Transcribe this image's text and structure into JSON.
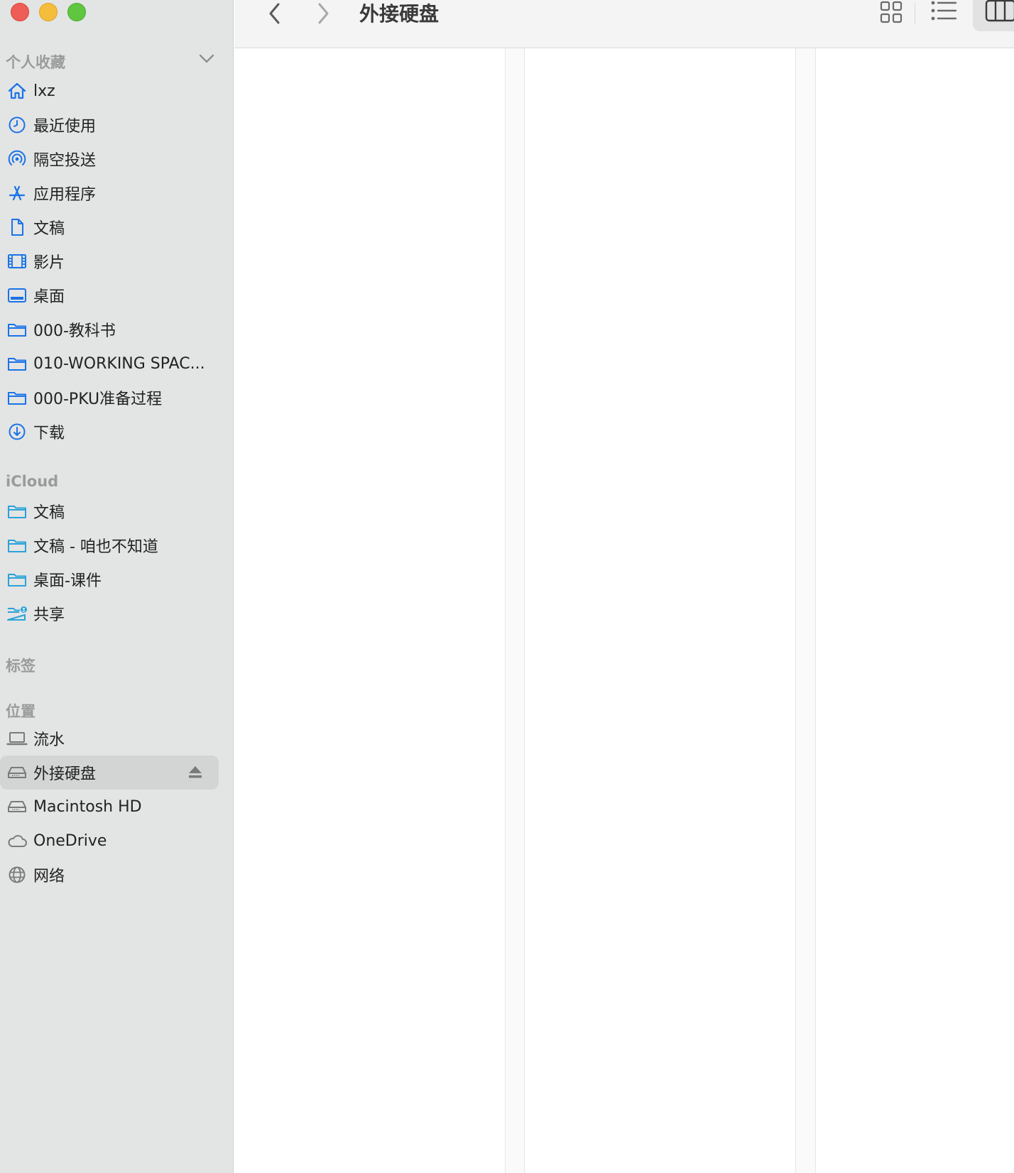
{
  "window": {
    "title": "外接硬盘"
  },
  "sidebar": {
    "favorites": {
      "title": "个人收藏",
      "items": [
        {
          "label": "lxz",
          "icon": "home-icon"
        },
        {
          "label": "最近使用",
          "icon": "clock-icon"
        },
        {
          "label": "隔空投送",
          "icon": "airdrop-icon"
        },
        {
          "label": "应用程序",
          "icon": "apps-icon"
        },
        {
          "label": "文稿",
          "icon": "document-icon"
        },
        {
          "label": "影片",
          "icon": "film-icon"
        },
        {
          "label": "桌面",
          "icon": "desktop-icon"
        },
        {
          "label": "000-教科书",
          "icon": "folder-icon"
        },
        {
          "label": "010-WORKING SPAC...",
          "icon": "folder-icon"
        },
        {
          "label": "000-PKU准备过程",
          "icon": "folder-icon"
        },
        {
          "label": "下载",
          "icon": "download-icon"
        }
      ]
    },
    "icloud": {
      "title": "iCloud",
      "items": [
        {
          "label": "文稿",
          "icon": "folder-icon"
        },
        {
          "label": "文稿 - 咱也不知道",
          "icon": "folder-icon"
        },
        {
          "label": "桌面-课件",
          "icon": "folder-icon"
        },
        {
          "label": "共享",
          "icon": "shared-folder-icon"
        }
      ]
    },
    "tags": {
      "title": "标签"
    },
    "locations": {
      "title": "位置",
      "items": [
        {
          "label": "流水",
          "icon": "laptop-icon"
        },
        {
          "label": "外接硬盘",
          "icon": "drive-icon",
          "selected": true
        },
        {
          "label": "Macintosh HD",
          "icon": "drive-icon"
        },
        {
          "label": "OneDrive",
          "icon": "cloud-icon"
        },
        {
          "label": "网络",
          "icon": "globe-icon"
        }
      ]
    }
  },
  "colors": {
    "accent": "#1a73e8",
    "sidebar_bg": "#e3e4e4",
    "selected_bg": "#d3d4d4"
  }
}
